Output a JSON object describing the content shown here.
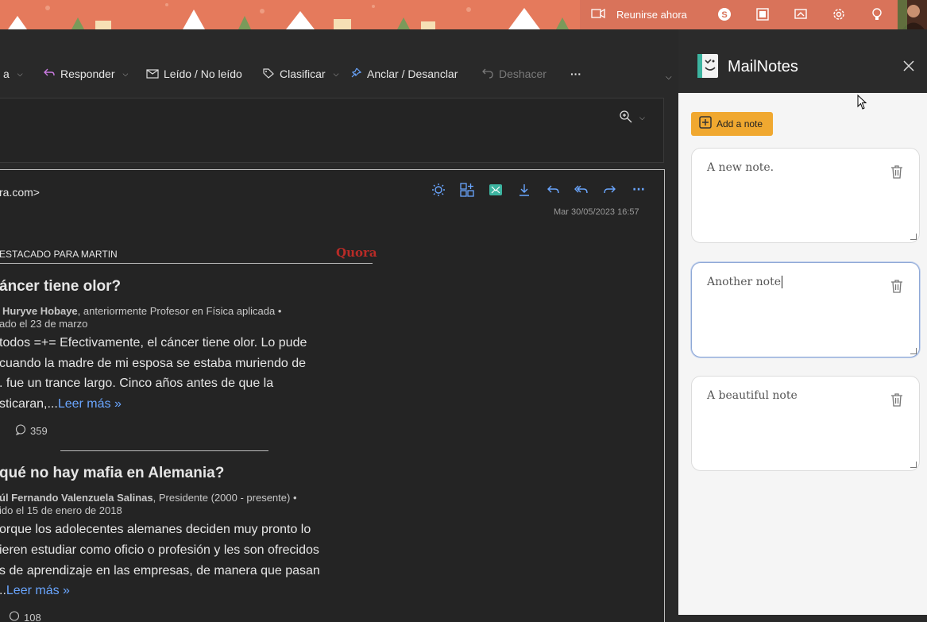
{
  "banner": {
    "meet_label": "Reunirse ahora",
    "icons": [
      "video-icon",
      "skype-icon",
      "office-icon",
      "whiteboard-icon",
      "settings-icon",
      "lightbulb-icon"
    ]
  },
  "ribbon": {
    "partial_label": "a",
    "reply_label": "Responder",
    "read_label": "Leído / No leído",
    "classify_label": "Clasificar",
    "pin_label": "Anclar / Desanclar",
    "undo_label": "Deshacer",
    "more_label": "···"
  },
  "message": {
    "sender_fragment": "ra.com>",
    "date": "Mar 30/05/2023 16:57",
    "digest_header": "ESTACADO PARA MARTIN",
    "brand": "Quora",
    "q1": {
      "title": "áncer tiene olor?",
      "author": "Huryve Hobaye",
      "author_suffix": ", anteriormente Profesor en Física aplicada •",
      "date_line": "ado el 23 de marzo",
      "lines": [
        "todos =+= Efectivamente, el cáncer tiene olor. Lo pude",
        "cuando la madre de mi esposa se estaba muriendo de",
        ". fue un trance largo. Cinco años antes de que la",
        "sticaran,..."
      ],
      "more": "Leer más »",
      "comments": "359"
    },
    "q2": {
      "title": "qué no hay mafia en Alemania?",
      "author": "úl Fernando Valenzuela Salinas",
      "author_suffix": ", Presidente (2000 - presente) •",
      "date_line": "ido el 15 de enero de 2018",
      "lines": [
        "orque los adolecentes alemanes deciden muy pronto lo",
        "ieren estudiar como oficio o profesión y les son ofrecidos",
        "s de aprendizaje en las empresas, de manera que pasan",
        ".."
      ],
      "more": "Leer más »",
      "comments": "108"
    }
  },
  "mailnotes": {
    "title": "MailNotes",
    "add_label": "Add a note",
    "notes": [
      "A new note.",
      "Another note",
      "A beautiful note"
    ]
  },
  "colors": {
    "accent": "#f0a830",
    "link": "#6aa6ff",
    "brand": "#b92b27"
  }
}
